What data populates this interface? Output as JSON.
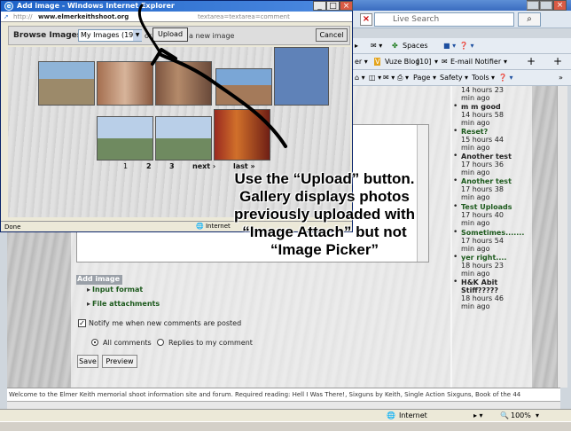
{
  "background_browser": {
    "search_placeholder": "Live Search",
    "links_bar": {
      "spaces": "Spaces"
    },
    "bookmarks_bar": {
      "vuze": "Vuze Blog",
      "vuze_count": "[10]",
      "email": "E-mail Notifier"
    },
    "commands_bar": {
      "page": "Page",
      "safety": "Safety",
      "tools": "Tools"
    },
    "status": {
      "zone": "Internet",
      "zoom": "100%"
    },
    "footer_text": "Welcome to the Elmer Keith memorial shoot information site and forum. Required reading: Hell I Was There!, Sixguns by Keith, Single Action Sixguns, Book of the 44"
  },
  "sidebar": {
    "items": [
      {
        "title": "",
        "meta": [
          "14 hours 23",
          "min ago"
        ]
      },
      {
        "title": "m m good",
        "meta": [
          "14 hours 58",
          "min ago"
        ]
      },
      {
        "title": "Reset?",
        "meta": [
          "15 hours 44",
          "min ago"
        ]
      },
      {
        "title": "Another test",
        "meta": [
          "17 hours 36",
          "min ago"
        ]
      },
      {
        "title": "Another test",
        "meta": [
          "17 hours 38",
          "min ago"
        ]
      },
      {
        "title": "Test Uploads",
        "meta": [
          "17 hours 40",
          "min ago"
        ]
      },
      {
        "title": "Sometimes.......",
        "meta": [
          "17 hours 54",
          "min ago"
        ]
      },
      {
        "title": "yer right....",
        "meta": [
          "18 hours 23",
          "min ago"
        ]
      },
      {
        "title": "H&K Abit Stiff?????",
        "meta": [
          "18 hours 46",
          "min ago"
        ]
      }
    ]
  },
  "form": {
    "add_image_label": "Add image",
    "input_format": "Input format",
    "file_attachments": "File attachments",
    "notify_label": "Notify me when new comments are posted",
    "radio_all": "All comments",
    "radio_replies": "Replies to my comment",
    "save_label": "Save",
    "preview_label": "Preview"
  },
  "popup": {
    "title": "Add image - Windows Internet Explorer",
    "url_domain": "www.elmerkeithshoot.org",
    "url_tail": "textarea=textarea=comment",
    "browse_label": "Browse Images:",
    "browse_value": "My Images (19)",
    "or_text": "or",
    "upload_label": "Upload",
    "new_image_text": "a new image",
    "cancel_label": "Cancel",
    "pager": [
      "1",
      "2",
      "3",
      "next ›",
      "last »"
    ],
    "status_text": "Done",
    "status_zone": "Internet"
  },
  "annotation": {
    "lines": [
      "Use the “Upload” button.",
      "Gallery displays photos",
      "previously uploaded with",
      "“Image Attach” but not",
      "“Image Picker”"
    ]
  },
  "colors": {
    "titlebar": "#3a6cc0",
    "accent_green": "#1d5a1d",
    "popup_bg": "#ece9d8"
  }
}
